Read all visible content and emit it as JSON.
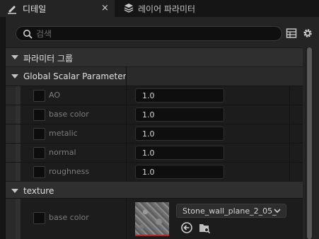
{
  "tabs": {
    "details": {
      "label": "디테일",
      "icon": "pencil-icon",
      "close": "×"
    },
    "layer_params": {
      "label": "레이어 파라미터",
      "icon": "layers-icon"
    }
  },
  "search": {
    "placeholder": "검색",
    "icon": "search-icon"
  },
  "toolbar": {
    "table_icon": "table-view-icon",
    "settings_icon": "gear-icon"
  },
  "sections": {
    "param_groups": "파라미터 그룹",
    "global_scalar": "Global Scalar Parameter V",
    "texture": "texture"
  },
  "scalar_params": [
    {
      "label": "AO",
      "value": "1.0"
    },
    {
      "label": "base color",
      "value": "1.0"
    },
    {
      "label": "metalic",
      "value": "1.0"
    },
    {
      "label": "normal",
      "value": "1.0"
    },
    {
      "label": "roughness",
      "value": "1.0"
    }
  ],
  "texture_param": {
    "label": "base color",
    "asset": "Stone_wall_plane_2_05_",
    "use_icon": "arrow-left-circle-icon",
    "browse_icon": "browse-folder-icon"
  },
  "colors": {
    "panel_bg": "#242424",
    "section_bg": "#2f2f2f",
    "row_bg": "#1c1c1c",
    "field_bg": "#0e0e0e"
  }
}
